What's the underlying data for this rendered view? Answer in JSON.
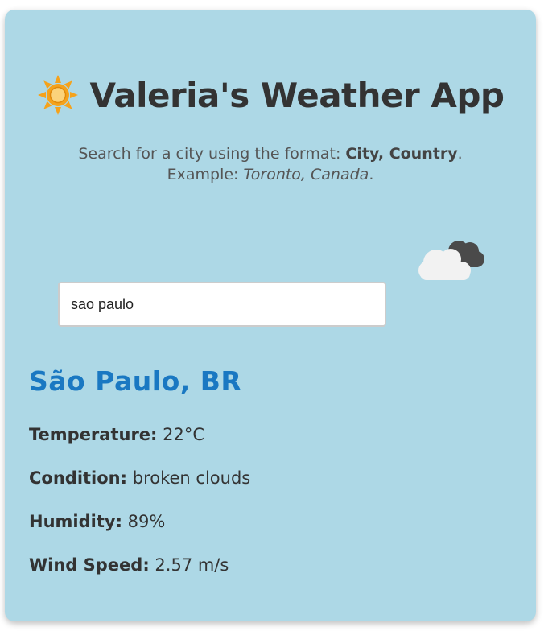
{
  "app": {
    "title": "Valeria's Weather App"
  },
  "instructions": {
    "line1_prefix": "Search for a city using the format: ",
    "format_bold": "City, Country",
    "line1_suffix": ".",
    "line2_prefix": "Example: ",
    "example_italic": "Toronto, Canada",
    "line2_suffix": "."
  },
  "search": {
    "value": "sao paulo",
    "placeholder": ""
  },
  "result": {
    "city": "São Paulo, BR",
    "temperature_label": "Temperature:",
    "temperature_value": "22°C",
    "condition_label": "Condition:",
    "condition_value": "broken clouds",
    "humidity_label": "Humidity:",
    "humidity_value": "89%",
    "wind_label": "Wind Speed:",
    "wind_value": "2.57 m/s"
  },
  "icons": {
    "title_icon": "sun-icon",
    "weather_icon": "broken-clouds-icon"
  },
  "colors": {
    "card_background": "#add8e6",
    "city_accent": "#1a78c2",
    "sun": "#f5a21b"
  }
}
